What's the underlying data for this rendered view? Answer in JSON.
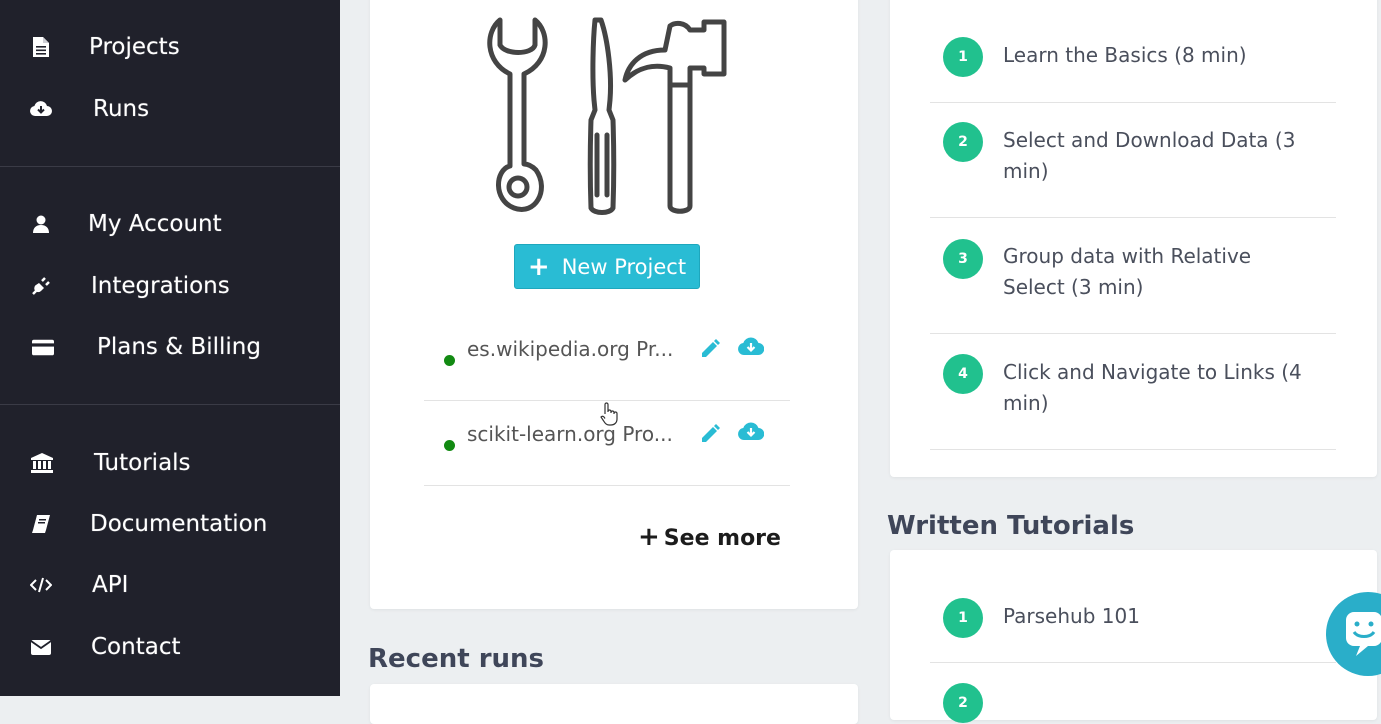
{
  "sidebar": {
    "items": [
      {
        "label": "Projects",
        "icon": "file-icon"
      },
      {
        "label": "Runs",
        "icon": "cloud-download-icon"
      },
      {
        "label": "My Account",
        "icon": "user-icon"
      },
      {
        "label": "Integrations",
        "icon": "plug-icon"
      },
      {
        "label": "Plans & Billing",
        "icon": "credit-card-icon"
      },
      {
        "label": "Tutorials",
        "icon": "university-icon"
      },
      {
        "label": "Documentation",
        "icon": "book-icon"
      },
      {
        "label": "API",
        "icon": "code-icon"
      },
      {
        "label": "Contact",
        "icon": "envelope-icon"
      }
    ]
  },
  "projects": {
    "new_project_label": "New Project",
    "items": [
      {
        "name": "es.wikipedia.org Pr...",
        "status_color": "#128a12"
      },
      {
        "name": "scikit-learn.org Pro...",
        "status_color": "#128a12"
      }
    ],
    "see_more_label": "See more"
  },
  "recent_runs": {
    "title": "Recent runs"
  },
  "video_tutorials": {
    "steps": [
      {
        "number": "1",
        "label": "Learn the Basics (8 min)"
      },
      {
        "number": "2",
        "label": "Select and Download Data (3 min)"
      },
      {
        "number": "3",
        "label": "Group data with Relative Select (3 min)"
      },
      {
        "number": "4",
        "label": "Click and Navigate to Links (4 min)"
      }
    ]
  },
  "written_tutorials": {
    "title": "Written Tutorials",
    "steps": [
      {
        "number": "1",
        "label": "Parsehub 101"
      },
      {
        "number": "2",
        "label": ""
      }
    ]
  },
  "colors": {
    "sidebar_bg": "#20212b",
    "accent": "#29bcd4",
    "step_badge": "#21c18e",
    "status_active": "#128a12"
  }
}
